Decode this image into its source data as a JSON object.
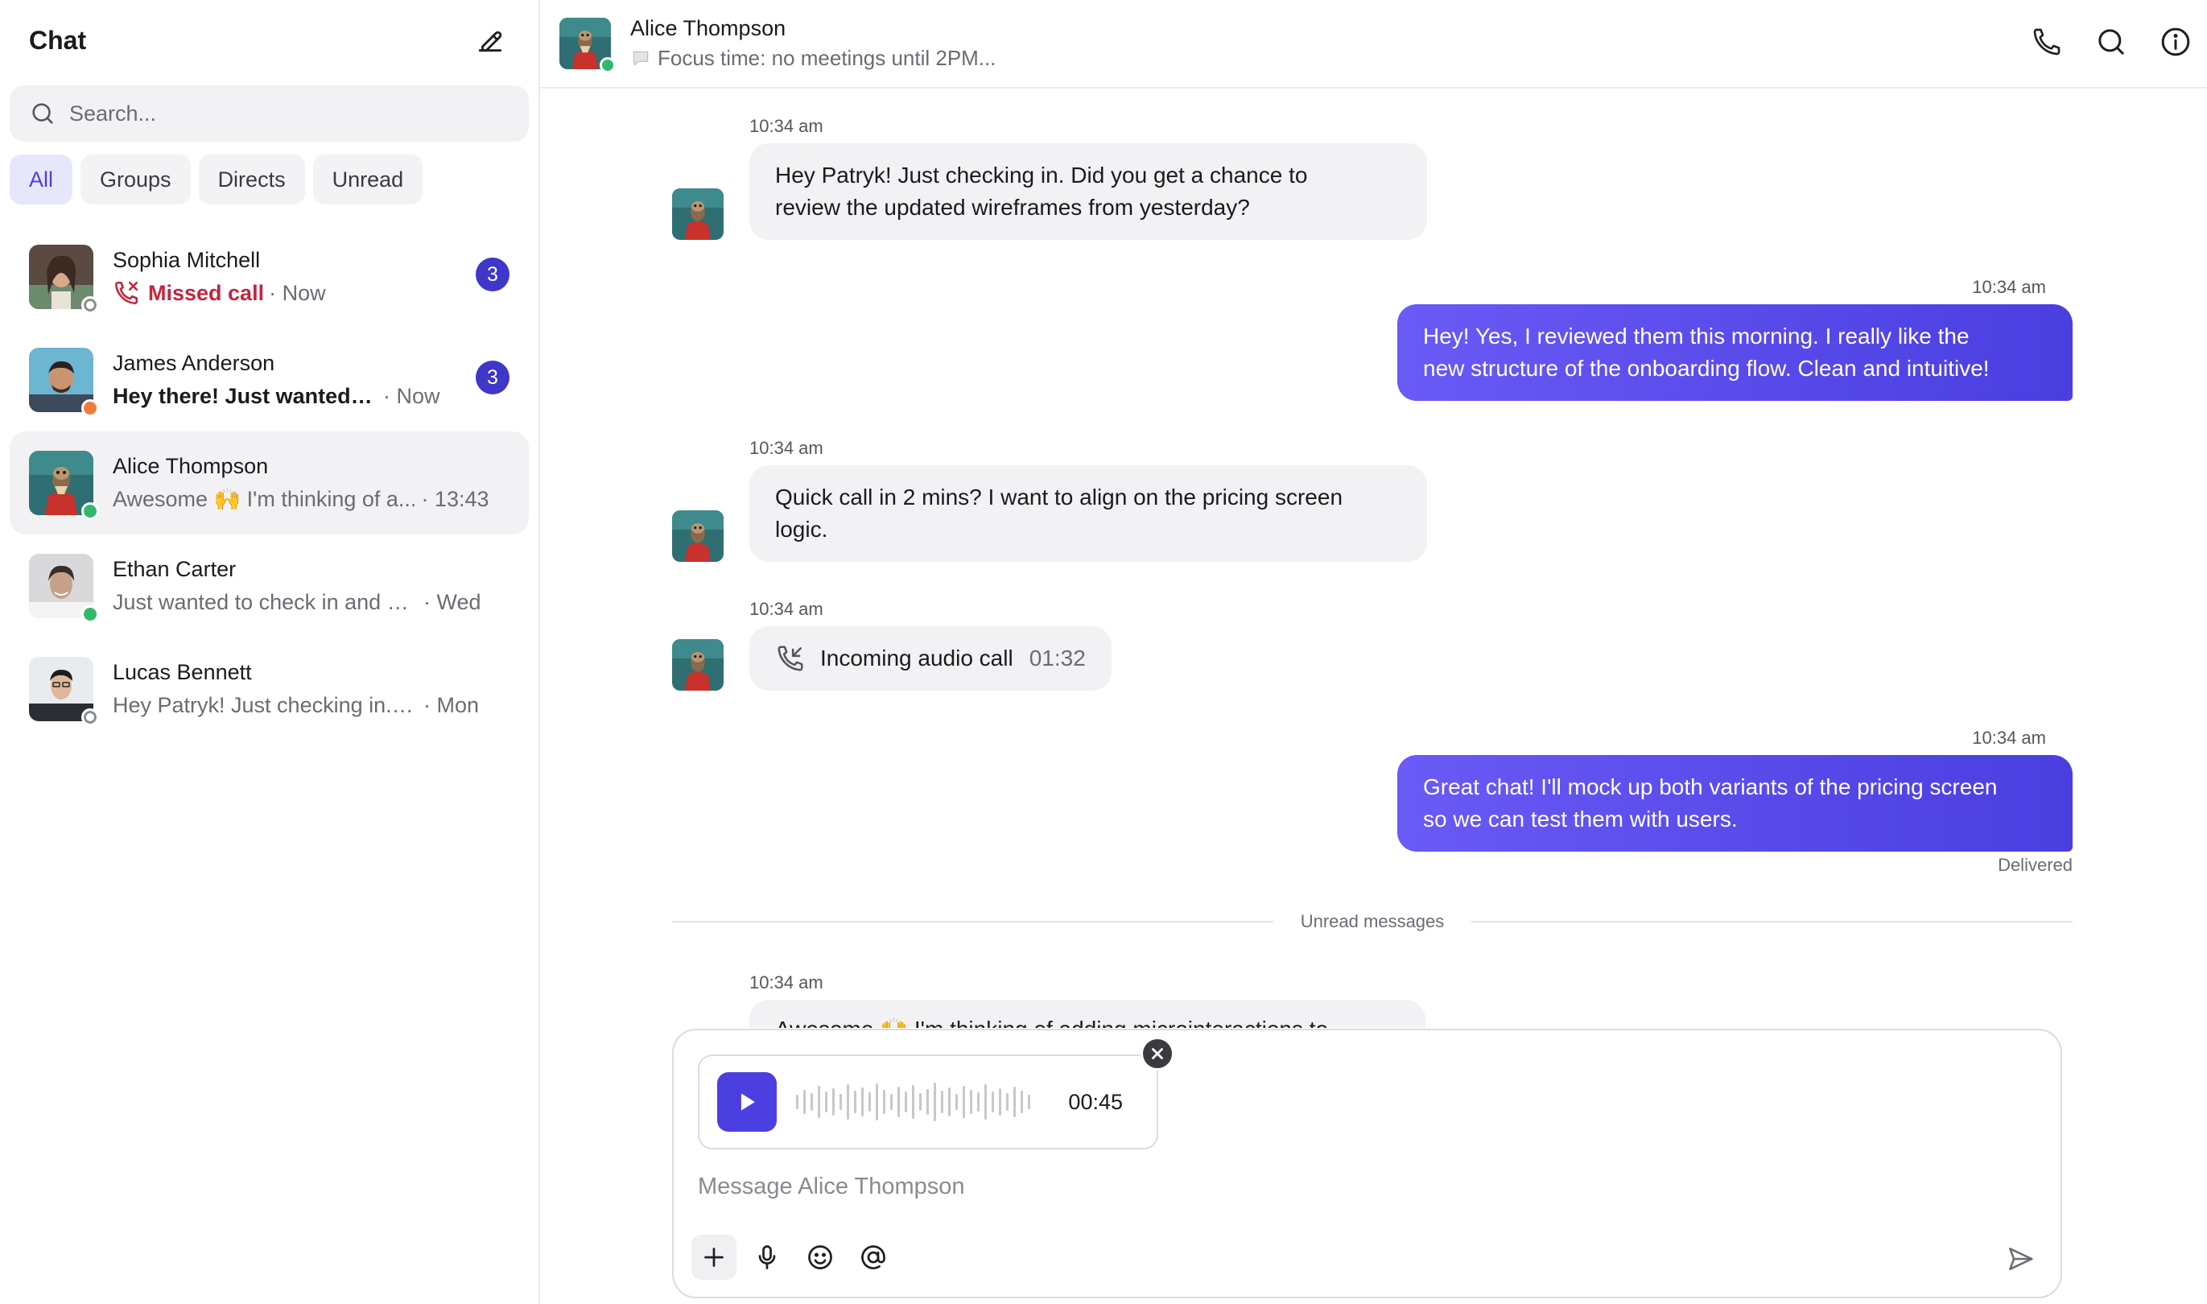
{
  "sidebar": {
    "title": "Chat",
    "compose_icon": "edit-icon",
    "search": {
      "placeholder": "Search..."
    },
    "filters": [
      {
        "label": "All",
        "active": true
      },
      {
        "label": "Groups",
        "active": false
      },
      {
        "label": "Directs",
        "active": false
      },
      {
        "label": "Unread",
        "active": false
      }
    ],
    "conversations": [
      {
        "name": "Sophia Mitchell",
        "preview": "Missed call",
        "preview_type": "missed-call",
        "time": "· Now",
        "badge": "3",
        "status": "offline"
      },
      {
        "name": "James Anderson",
        "preview": "Hey there! Just wanted t...",
        "preview_type": "unread",
        "time": "· Now",
        "badge": "3",
        "status": "away"
      },
      {
        "name": "Alice Thompson",
        "preview": "Awesome 🙌 I'm thinking of a...",
        "preview_type": "normal",
        "time": "· 13:43",
        "badge": "",
        "status": "online",
        "selected": true
      },
      {
        "name": "Ethan Carter",
        "preview": "Just wanted to check in and se...",
        "preview_type": "normal",
        "time": "· Wed",
        "badge": "",
        "status": "online"
      },
      {
        "name": "Lucas Bennett",
        "preview": "Hey Patryk! Just checking in. D...",
        "preview_type": "normal",
        "time": "· Mon",
        "badge": "",
        "status": "offline"
      }
    ]
  },
  "header": {
    "name": "Alice Thompson",
    "status_text": "Focus time: no meetings until 2PM...",
    "status_icon": "speech-bubble-icon",
    "actions": [
      "phone-icon",
      "search-icon",
      "info-icon"
    ]
  },
  "messages": [
    {
      "time": "10:34 am",
      "text_line1": "Hey Patryk! Just checking in. Did you get a chance to",
      "text_line2": "review the updated wireframes from yesterday?"
    },
    {
      "time": "10:34 am",
      "text_line1": "Hey! Yes, I reviewed them this morning. I really like the",
      "text_line2": "new structure of the onboarding flow. Clean and intuitive!"
    },
    {
      "time": "10:34 am",
      "text_line1": "Quick call in 2 mins? I want to align on the pricing screen",
      "text_line2": "logic."
    },
    {
      "time": "10:34 am",
      "call_label": "Incoming audio call",
      "call_duration": "01:32"
    },
    {
      "time": "10:34 am",
      "text_line1": "Great chat! I'll mock up both variants of the pricing screen",
      "text_line2": "so we can test them with users.",
      "receipt": "Delivered"
    },
    {
      "time": "10:34 am",
      "text_line1": "Awesome 🙌 I'm thinking of adding microinteractions to"
    }
  ],
  "unread_divider": "Unread messages",
  "composer": {
    "placeholder": "Message Alice Thompson",
    "audio_duration": "00:45",
    "tools": [
      "plus-icon",
      "microphone-icon",
      "emoji-icon",
      "mention-icon"
    ]
  },
  "colors": {
    "accent": "#4b3fe0",
    "badge": "#3f37c9",
    "missed": "#c3263e",
    "online": "#33b86b",
    "away": "#f07b3f"
  }
}
